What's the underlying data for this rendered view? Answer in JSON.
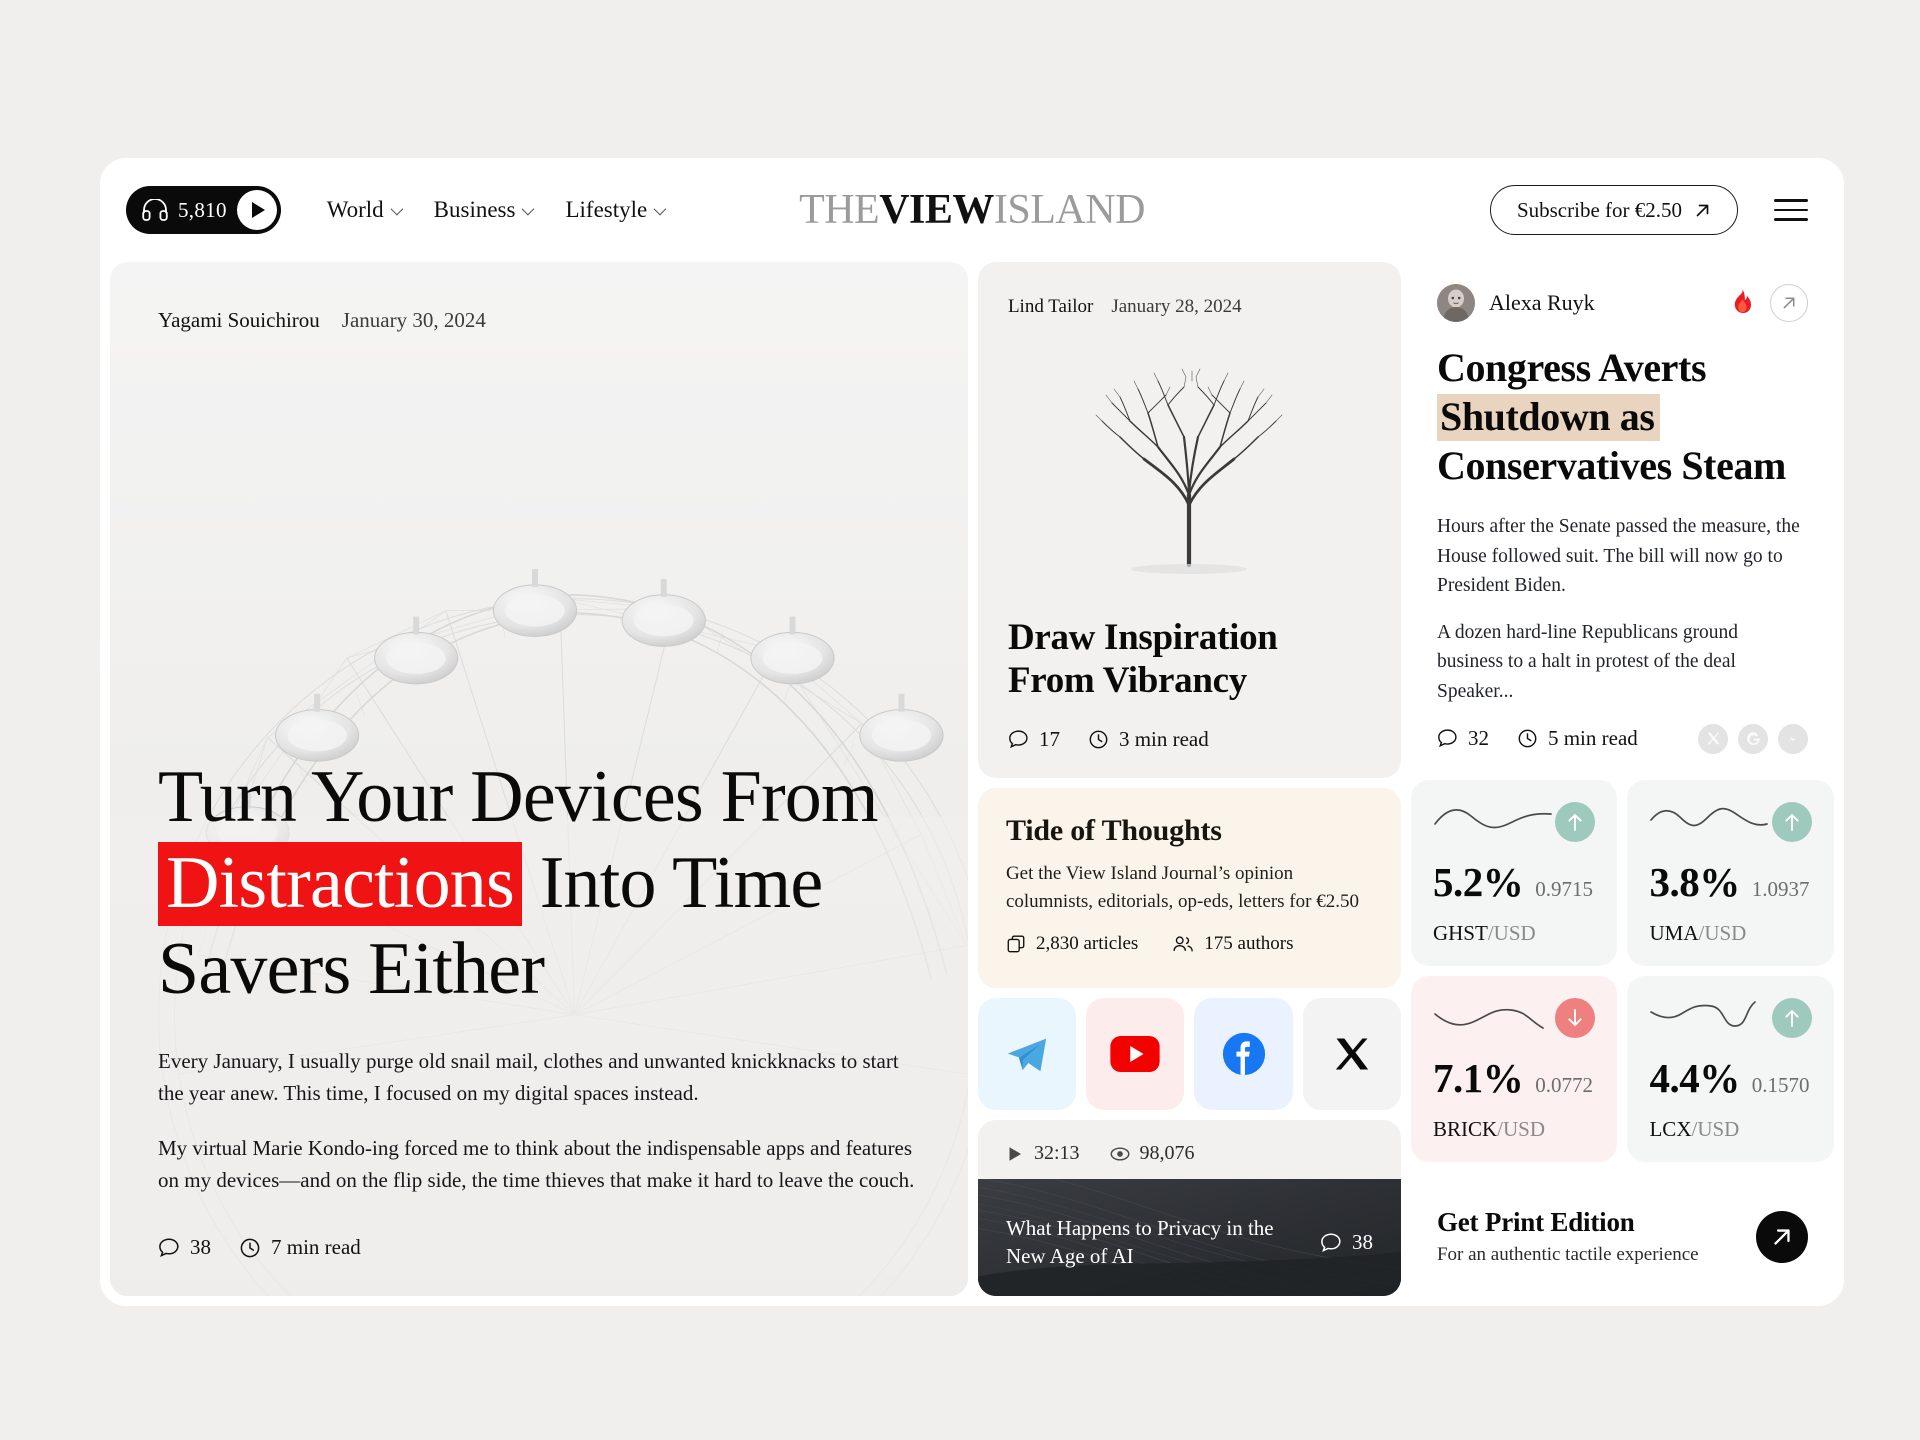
{
  "header": {
    "audio": {
      "count": "5,810",
      "icon": "headphones-icon",
      "play_icon": "play-icon"
    },
    "nav": [
      {
        "label": "World"
      },
      {
        "label": "Business"
      },
      {
        "label": "Lifestyle"
      }
    ],
    "logo": {
      "part1": "THE",
      "part2": "VIEW",
      "part3": "ISLAND"
    },
    "subscribe": {
      "label": "Subscribe for €2.50",
      "icon": "arrow-up-right-icon"
    },
    "menu_icon": "hamburger-menu-icon"
  },
  "hero": {
    "author": "Yagami Souichirou",
    "date": "January 30, 2024",
    "title_line1": "Turn Your Devices From",
    "title_highlight": "Distractions",
    "title_line2_rest": " Into Time",
    "title_line3": "Savers Either",
    "paragraph1": "Every January, I usually purge old snail mail, clothes and unwanted knickknacks to start the year anew. This time, I focused on my digital spaces instead.",
    "paragraph2": "My virtual Marie Kondo-ing forced me to think about the indispensable apps and features on my devices—and on the flip side, the time thieves that make it hard to leave the couch.",
    "comments": "38",
    "read_time": "7 min read",
    "highlight_color": "#ef1313"
  },
  "vibrancy": {
    "author": "Lind Tailor",
    "date": "January 28, 2024",
    "title_line1": "Draw Inspiration",
    "title_line2": "From Vibrancy",
    "comments": "17",
    "read_time": "3 min read"
  },
  "tide": {
    "title": "Tide of Thoughts",
    "subtitle_line1": "Get the View Island Journal’s opinion",
    "subtitle_line2": "columnists, editorials, op-eds, letters for €2.50",
    "articles": "2,830 articles",
    "authors": "175 authors",
    "bg_color": "#faf4ea"
  },
  "socials": [
    {
      "name": "telegram",
      "bg": "#eaf6fd"
    },
    {
      "name": "youtube",
      "bg": "#fdecec"
    },
    {
      "name": "facebook",
      "bg": "#e9f2fe"
    },
    {
      "name": "x-twitter",
      "bg": "#f3f3f3"
    }
  ],
  "video": {
    "duration": "32:13",
    "views": "98,076",
    "title_line1": "What Happens to Privacy in the",
    "title_line2": "New Age of AI",
    "comments": "38"
  },
  "news": {
    "author": "Alexa Ruyk",
    "trending_icon": "fire-icon",
    "open_icon": "arrow-up-right-icon",
    "title_line1": "Congress Averts",
    "title_highlight": "Shutdown as",
    "title_line3": "Conservatives Steam",
    "highlight_color": "#e9d5bf",
    "paragraph1": "Hours after the Senate passed the measure, the House followed suit. The bill will now go to President Biden.",
    "paragraph2": "A dozen hard-line Republicans ground business to a halt in protest of the deal Speaker...",
    "comments": "32",
    "read_time": "5 min read",
    "share": [
      {
        "name": "x-twitter-share-icon"
      },
      {
        "name": "google-share-icon"
      },
      {
        "name": "messenger-share-icon"
      }
    ]
  },
  "tickers": [
    {
      "percent": "5.2%",
      "value": "0.9715",
      "symbol": "GHST",
      "quote": "/USD",
      "direction": "up",
      "bg": "#f4f6f5",
      "badge": "#9ec9bd"
    },
    {
      "percent": "3.8%",
      "value": "1.0937",
      "symbol": "UMA",
      "quote": "/USD",
      "direction": "up",
      "bg": "#f4f6f5",
      "badge": "#9ec9bd"
    },
    {
      "percent": "7.1%",
      "value": "0.0772",
      "symbol": "BRICK",
      "quote": "/USD",
      "direction": "down",
      "bg": "#fdf0f0",
      "badge": "#ef8080"
    },
    {
      "percent": "4.4%",
      "value": "0.1570",
      "symbol": "LCX",
      "quote": "/USD",
      "direction": "up",
      "bg": "#f4f6f5",
      "badge": "#9ec9bd"
    }
  ],
  "print": {
    "title": "Get Print Edition",
    "subtitle": "For an authentic tactile experience",
    "button_icon": "arrow-up-right-icon"
  }
}
